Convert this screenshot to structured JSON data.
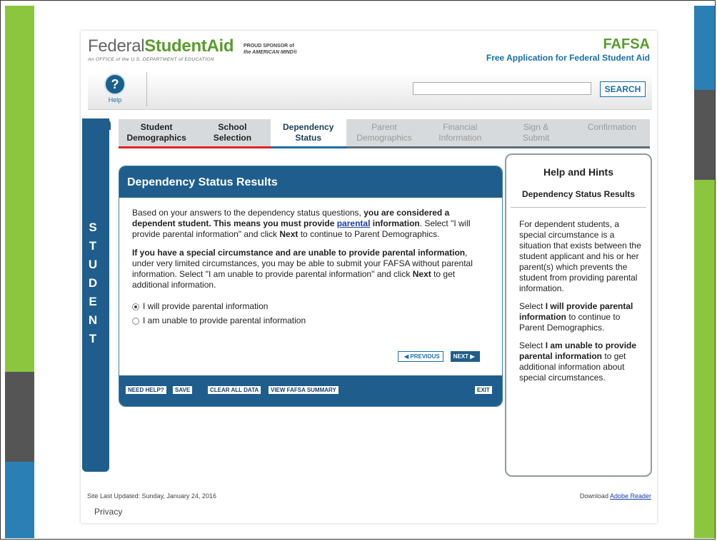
{
  "header": {
    "logo_federal": "Federal",
    "logo_student": "Student",
    "logo_aid": "Aid",
    "logo_sub": "An OFFICE of the U.S. DEPARTMENT of EDUCATION",
    "sponsor_line1": "PROUD SPONSOR of",
    "sponsor_line2": "the AMERICAN MIND®",
    "fafsa_word": "FAFSA",
    "fafsa_tag": "Free Application for Federal Student Aid"
  },
  "toolbar": {
    "help_icon": "?",
    "help_label": "Help",
    "search_value": "",
    "search_button": "SEARCH"
  },
  "sidebar": {
    "letters": [
      "S",
      "T",
      "U",
      "D",
      "E",
      "N",
      "T"
    ]
  },
  "tabs": [
    {
      "line1": "Student",
      "line2": "Demographics",
      "state": "done"
    },
    {
      "line1": "School",
      "line2": "Selection",
      "state": "done"
    },
    {
      "line1": "Dependency",
      "line2": "Status",
      "state": "active"
    },
    {
      "line1": "Parent",
      "line2": "Demographics",
      "state": "pending"
    },
    {
      "line1": "Financial",
      "line2": "Information",
      "state": "pending"
    },
    {
      "line1": "Sign &",
      "line2": "Submit",
      "state": "pending"
    },
    {
      "line1": "Confirmation",
      "line2": "",
      "state": "pending"
    }
  ],
  "main": {
    "title": "Dependency Status Results",
    "para1_a": "Based on your answers to the dependency status questions, ",
    "para1_b": "you are considered a dependent student. This means you must provide ",
    "para1_link": "parental",
    "para1_c": " information",
    "para1_d": ". Select \"I will provide parental information\" and click ",
    "para1_e": "Next",
    "para1_f": " to continue to Parent Demographics.",
    "para2_a": "If you have a special circumstance and are unable to provide parental information",
    "para2_b": ", under very limited circumstances, you may be able to submit your FAFSA without parental information. Select \"I am unable to provide parental information\" and click ",
    "para2_c": "Next",
    "para2_d": " to get additional information.",
    "option1": "I will provide parental information",
    "option2": "I am unable to provide parental information",
    "selected_option": 1,
    "previous": "PREVIOUS",
    "next": "NEXT"
  },
  "footer_buttons": {
    "need_help": "NEED HELP?",
    "save": "SAVE",
    "clear": "CLEAR ALL DATA",
    "summary": "VIEW FAFSA SUMMARY",
    "exit": "EXIT"
  },
  "hints": {
    "title": "Help and Hints",
    "subtitle": "Dependency Status Results",
    "p1": "For dependent students, a special circumstance is a situation that exists between the student applicant and his or her parent(s) which prevents the student from providing parental information.",
    "p2_a": "Select ",
    "p2_b": "I will provide parental information",
    "p2_c": " to continue to Parent Demographics.",
    "p3_a": "Select ",
    "p3_b": "I am unable to provide parental information",
    "p3_c": " to get additional information about special circumstances."
  },
  "page_footer": {
    "updated": "Site Last Updated: Sunday, January 24, 2016",
    "download": "Download ",
    "adobe": "Adobe Reader",
    "privacy": "Privacy"
  },
  "colors": {
    "green": "#8cc63f",
    "dark_gray": "#555555",
    "blue": "#2a7fb5",
    "brand_blue": "#1f5e8c"
  }
}
